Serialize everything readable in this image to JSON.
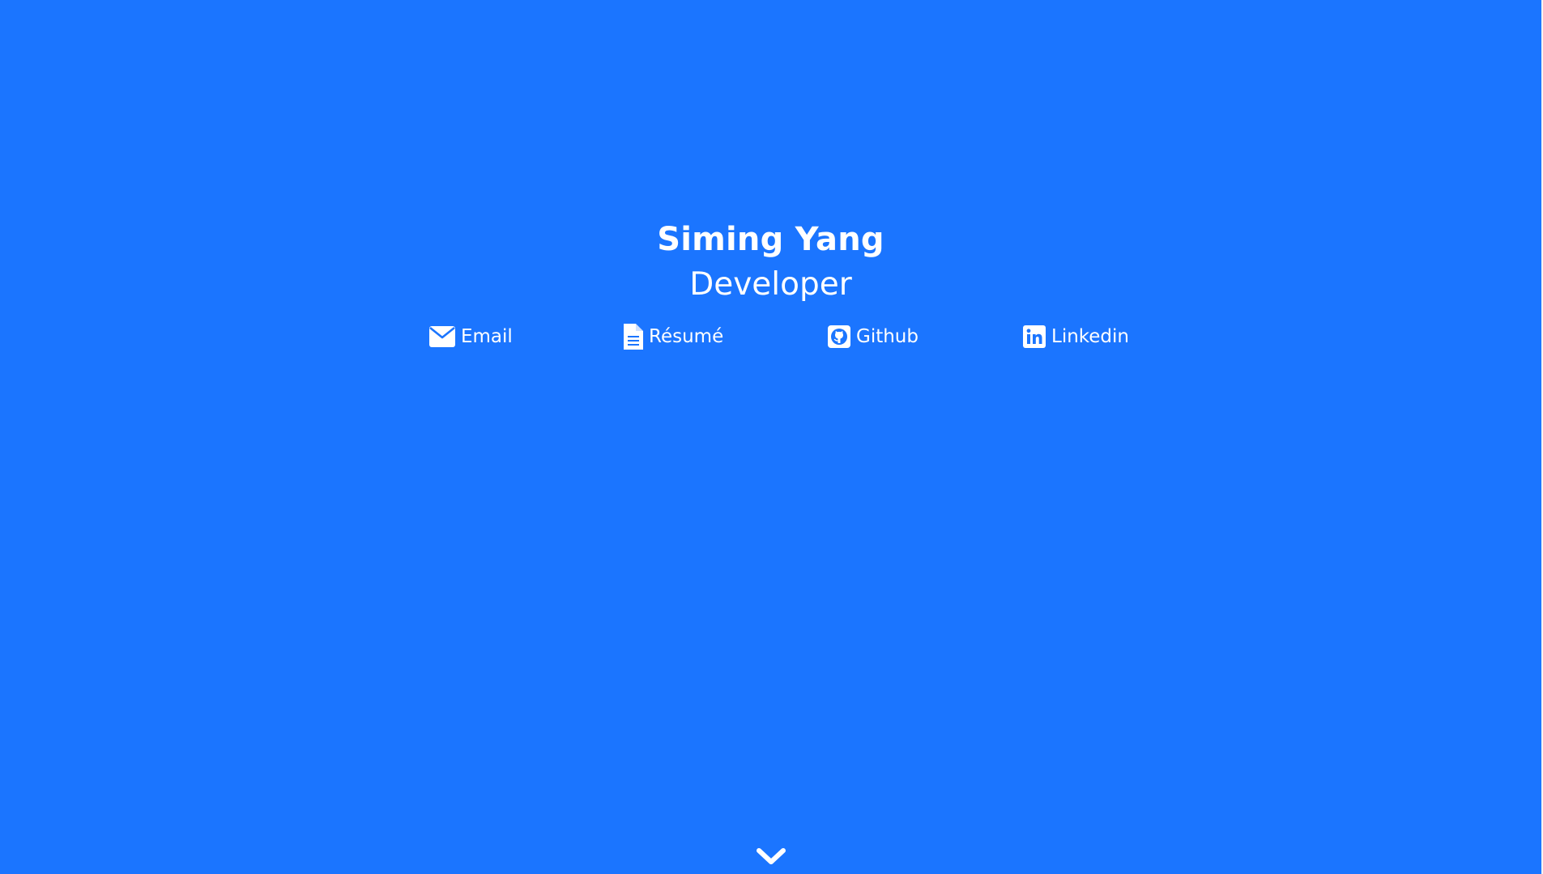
{
  "profile": {
    "name": "Siming Yang",
    "title": "Developer"
  },
  "links": [
    {
      "label": "Email",
      "icon": "envelope-icon"
    },
    {
      "label": "Résumé",
      "icon": "document-icon"
    },
    {
      "label": "Github",
      "icon": "github-icon"
    },
    {
      "label": "Linkedin",
      "icon": "linkedin-icon"
    }
  ],
  "scroll": {
    "icon": "chevron-down-icon"
  },
  "colors": {
    "background": "#1b75ff",
    "text": "#ffffff"
  }
}
